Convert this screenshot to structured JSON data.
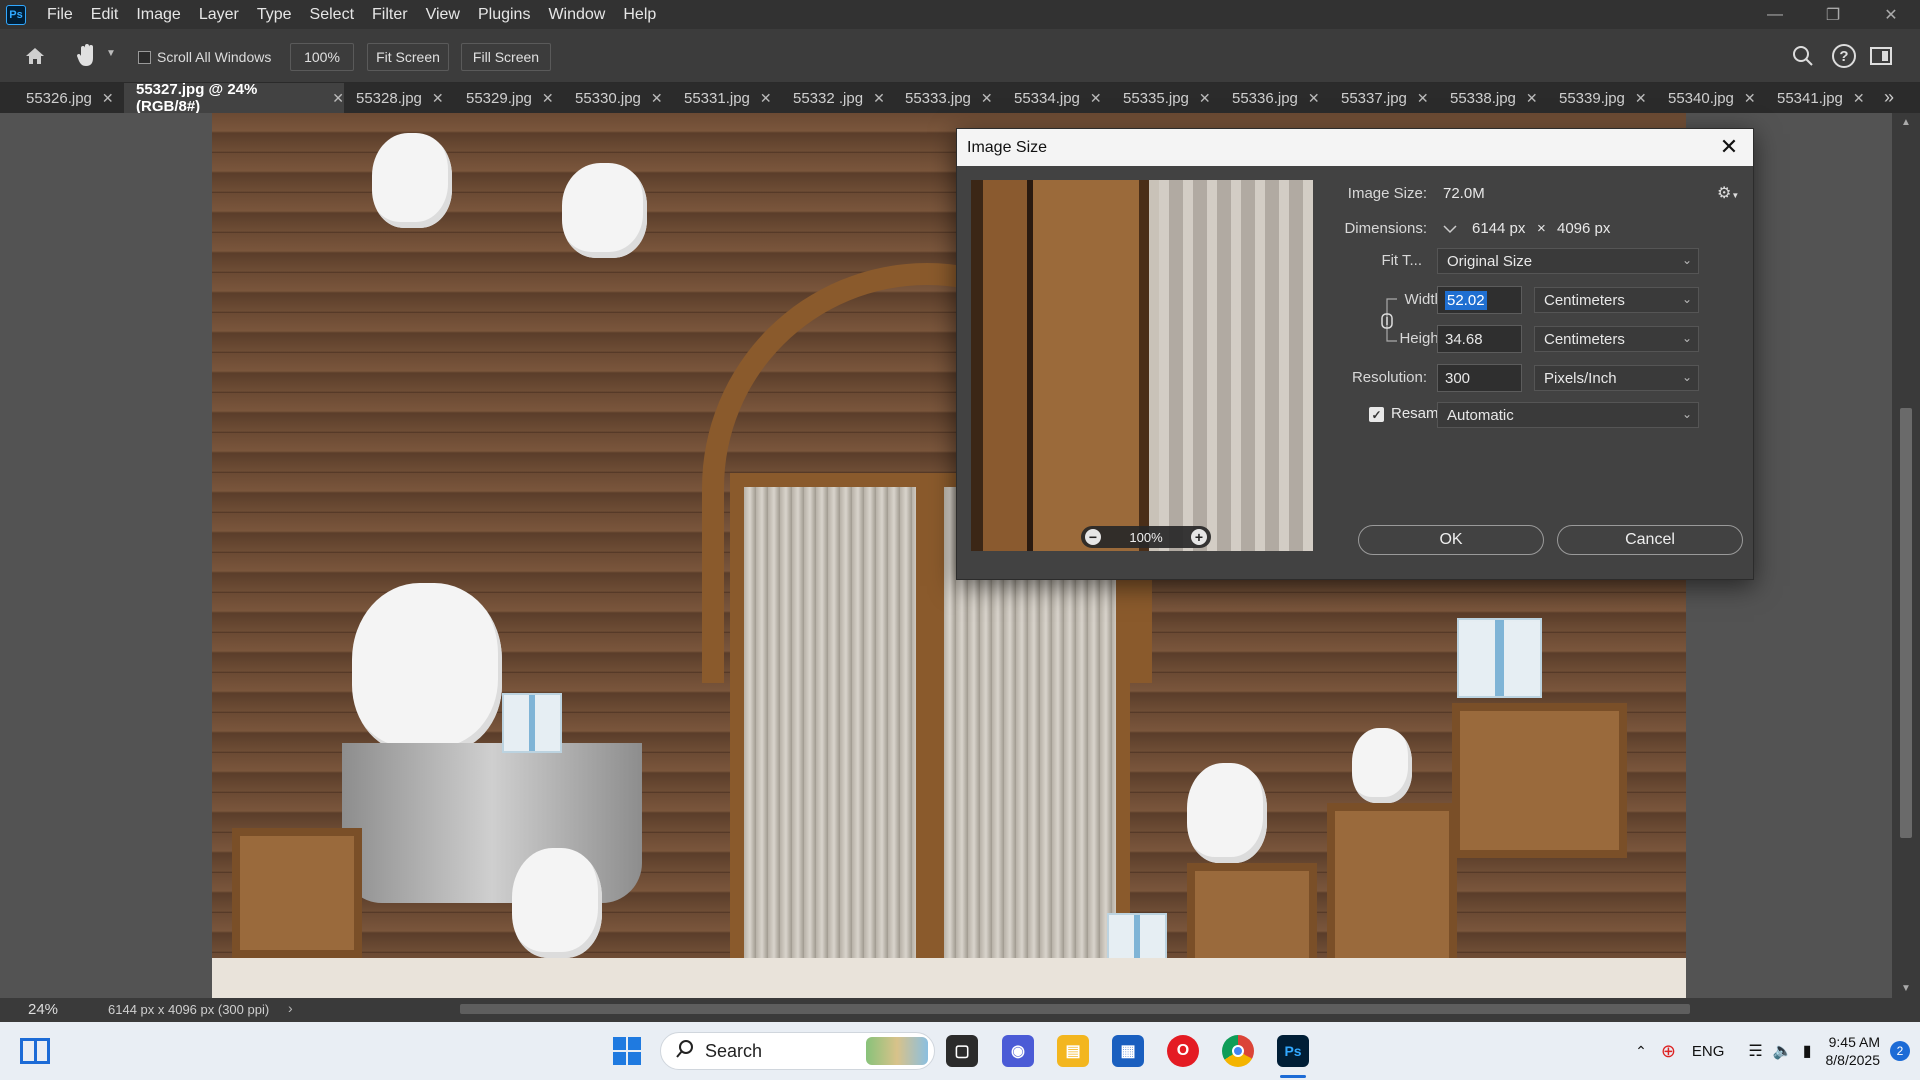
{
  "menubar": {
    "logo": "Ps",
    "items": [
      "File",
      "Edit",
      "Image",
      "Layer",
      "Type",
      "Select",
      "Filter",
      "View",
      "Plugins",
      "Window",
      "Help"
    ]
  },
  "options": {
    "scroll_all_windows": "Scroll All Windows",
    "zoom_btn": "100%",
    "fit_screen": "Fit Screen",
    "fill_screen": "Fill Screen"
  },
  "tabs": [
    {
      "label": "55326.jpg"
    },
    {
      "label": "55327.jpg @ 24% (RGB/8#)",
      "active": true
    },
    {
      "label": "55328.jpg"
    },
    {
      "label": "55329.jpg"
    },
    {
      "label": "55330.jpg"
    },
    {
      "label": "55331.jpg"
    },
    {
      "label": "55332 .jpg"
    },
    {
      "label": "55333.jpg"
    },
    {
      "label": "55334.jpg"
    },
    {
      "label": "55335.jpg"
    },
    {
      "label": "55336.jpg"
    },
    {
      "label": "55337.jpg"
    },
    {
      "label": "55338.jpg"
    },
    {
      "label": "55339.jpg"
    },
    {
      "label": "55340.jpg"
    },
    {
      "label": "55341.jpg"
    }
  ],
  "status": {
    "zoom": "24%",
    "doc_info": "6144 px x 4096 px (300 ppi)"
  },
  "dialog": {
    "title": "Image Size",
    "image_size_label": "Image Size:",
    "image_size_value": "72.0M",
    "dimensions_label": "Dimensions:",
    "dim_width": "6144 px",
    "dim_x": "×",
    "dim_height": "4096 px",
    "fit_label": "Fit T...",
    "fit_value": "Original Size",
    "width_label": "Width:",
    "width_value": "52.02",
    "width_unit": "Centimeters",
    "height_label": "Height:",
    "height_value": "34.68",
    "height_unit": "Centimeters",
    "resolution_label": "Resolution:",
    "resolution_value": "300",
    "resolution_unit": "Pixels/Inch",
    "resample_label": "Resample:",
    "resample_value": "Automatic",
    "preview_zoom": "100%",
    "ok": "OK",
    "cancel": "Cancel"
  },
  "taskbar": {
    "search_placeholder": "Search",
    "language": "ENG",
    "time": "9:45 AM",
    "date": "8/8/2025",
    "notification_count": "2"
  }
}
